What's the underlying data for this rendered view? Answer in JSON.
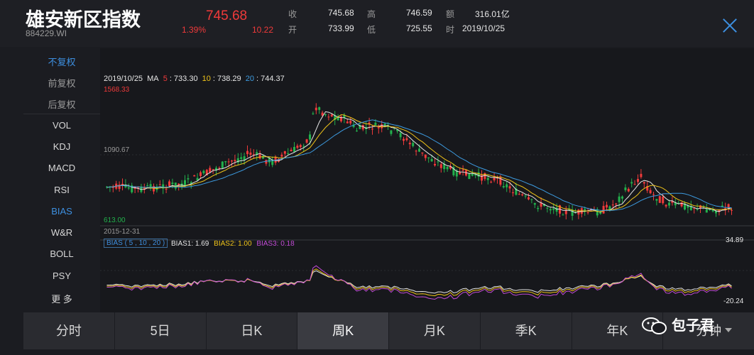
{
  "header": {
    "title": "雄安新区指数",
    "code": "884229.WI",
    "price": "745.68",
    "pct": "1.39%",
    "change": "10.22",
    "stats": [
      {
        "label": "收",
        "value": "745.68"
      },
      {
        "label": "高",
        "value": "746.59"
      },
      {
        "label": "额",
        "value": "316.01亿"
      },
      {
        "label": "开",
        "value": "733.99"
      },
      {
        "label": "低",
        "value": "725.55"
      },
      {
        "label": "时",
        "value": "2019/10/25"
      }
    ]
  },
  "sidebar": {
    "items": [
      {
        "label": "不复权",
        "active": true
      },
      {
        "label": "前复权"
      },
      {
        "label": "后复权"
      },
      {
        "label": "VOL"
      },
      {
        "label": "KDJ"
      },
      {
        "label": "MACD"
      },
      {
        "label": "RSI"
      },
      {
        "label": "BIAS",
        "active": true
      },
      {
        "label": "W&R"
      },
      {
        "label": "BOLL"
      },
      {
        "label": "PSY"
      },
      {
        "label": "更 多"
      }
    ]
  },
  "chart": {
    "date": "2019/10/25",
    "ma_label": "MA",
    "ma5_label": "5",
    "ma5_value": ": 733.30",
    "ma10_label": "10",
    "ma10_value": ": 738.29",
    "ma20_label": "20",
    "ma20_value": ": 744.37",
    "high_label": "1568.33",
    "mid_label": "1090.67",
    "low_label": "613.00",
    "start_date": "2015-12-31",
    "bias_box": "BIAS ( 5 , 10 , 20 )",
    "bias1": "BIAS1: 1.69",
    "bias2": "BIAS2: 1.00",
    "bias3": "BIAS3: 0.18",
    "bias_max": "34.89",
    "bias_min": "-20.24",
    "colors": {
      "up": "#f03a3a",
      "down": "#22b14c",
      "ma5": "#e6e6e6",
      "ma10": "#f0c419",
      "ma20": "#3d9be0",
      "bias3": "#c24bd6"
    }
  },
  "tabs": [
    {
      "label": "分时"
    },
    {
      "label": "5日"
    },
    {
      "label": "日K"
    },
    {
      "label": "周K",
      "active": true
    },
    {
      "label": "月K"
    },
    {
      "label": "季K"
    },
    {
      "label": "年K"
    },
    {
      "label": "分钟"
    }
  ],
  "watermark": "包子君"
}
